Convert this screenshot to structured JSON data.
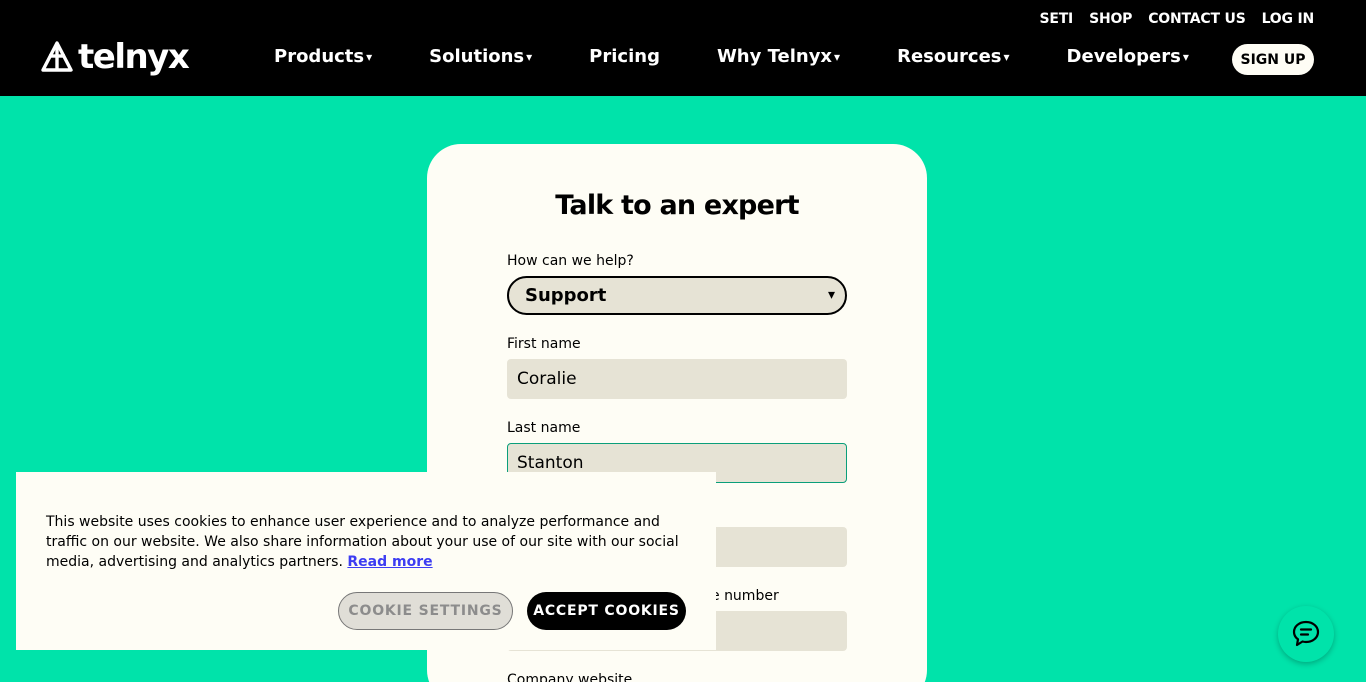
{
  "header": {
    "logo_text": "telnyx",
    "utility_links": [
      "SETI",
      "SHOP",
      "CONTACT US",
      "LOG IN"
    ],
    "nav": [
      {
        "label": "Products",
        "has_dropdown": true
      },
      {
        "label": "Solutions",
        "has_dropdown": true
      },
      {
        "label": "Pricing",
        "has_dropdown": false
      },
      {
        "label": "Why Telnyx",
        "has_dropdown": true
      },
      {
        "label": "Resources",
        "has_dropdown": true
      },
      {
        "label": "Developers",
        "has_dropdown": true
      }
    ],
    "signup_label": "SIGN UP",
    "caret": "▾"
  },
  "form": {
    "title": "Talk to an expert",
    "help_label": "How can we help?",
    "help_value": "Support",
    "first_name_label": "First name",
    "first_name_value": "Coralie",
    "last_name_label": "Last name",
    "last_name_value": "Stanton",
    "phone_label_partial": "e number",
    "company_website_label": "Company website"
  },
  "cookie": {
    "text": "This website uses cookies to enhance user experience and to analyze performance and traffic on our website. We also share information about your use of our site with our social media, advertising and analytics partners.",
    "read_more": "Read more",
    "settings_label": "COOKIE SETTINGS",
    "accept_label": "ACCEPT COOKIES"
  },
  "colors": {
    "brand_green": "#00e3aa",
    "header_bg": "#000000",
    "card_bg": "#fefdf5",
    "input_bg": "#e6e3d5",
    "link": "#3d3df2"
  }
}
